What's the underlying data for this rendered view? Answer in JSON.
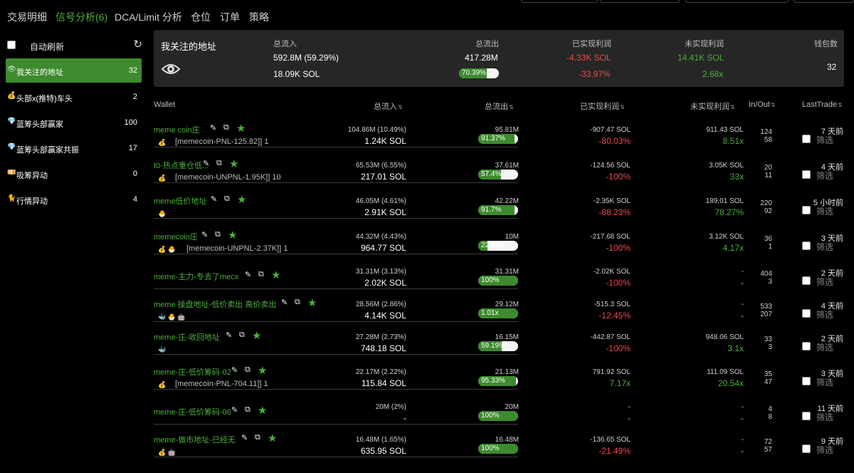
{
  "nav": {
    "tabs": [
      "交易明细",
      "信号分析(6)",
      "DCA/Limit 分析",
      "仓位",
      "订单",
      "策略"
    ],
    "active_index": 1
  },
  "sidebar": {
    "auto_refresh_label": "自动刷新",
    "items": [
      {
        "icon": "eye-icon",
        "glyph": "👁",
        "label": "我关注的地址",
        "count": "32",
        "active": true
      },
      {
        "icon": "money-bag-icon",
        "glyph": "💰",
        "label": "头部x(推特)车头",
        "count": "2"
      },
      {
        "icon": "diamond-icon",
        "glyph": "💎",
        "label": "蓝筹头部赢家",
        "count": "100"
      },
      {
        "icon": "diamond-icon",
        "glyph": "💎",
        "label": "蓝筹头部赢家共振",
        "count": "17"
      },
      {
        "icon": "cash-icon",
        "glyph": "💴",
        "label": "吸筹异动",
        "count": "0"
      },
      {
        "icon": "cat-icon",
        "glyph": "🐈",
        "label": "行情异动",
        "count": "4"
      }
    ]
  },
  "summary": {
    "title": "我关注的地址",
    "h_inflow": "总流入",
    "h_outflow": "总流出",
    "h_realized": "已实现利润",
    "h_unrealized": "未实现利润",
    "h_wallets": "钱包数",
    "inflow_1": "592.8M (59.29%)",
    "inflow_2": "18.09K SOL",
    "outflow": "417.28M",
    "outflow_pct": "70.39%",
    "outflow_pct_value": 70.39,
    "realized_1": "-4.33K SOL",
    "realized_2": "-33.97%",
    "unrealized_1": "14.41K SOL",
    "unrealized_2": "2.68x",
    "wallets": "32"
  },
  "table": {
    "headers": {
      "wallet": "Wallet",
      "inflow": "总流入",
      "outflow": "总流出",
      "realized": "已实现利润",
      "unrealized": "未实现利润",
      "inout": "In/Out",
      "lasttrade": "LastTrade"
    },
    "filter_label": "筛选",
    "rows": [
      {
        "name": "meme coin庄",
        "emojis": "💰",
        "tag": "[memecoin-PNL-125.82]] 1",
        "in1": "104.86M (10.49%)",
        "in2": "1.24K SOL",
        "out1": "95.81M",
        "outpct": "91.37%",
        "outval": 91.37,
        "r1": "-907.47 SOL",
        "r2": "-80.03%",
        "rcolor": "red",
        "u1": "911.43 SOL",
        "u2": "8.51x",
        "ucolor": "green",
        "inn": "124",
        "outn": "58",
        "last": "7 天前"
      },
      {
        "name": "t0-热点重仓低...",
        "emojis": "💰",
        "tag": "[memecoin-UNPNL-1.95K]] 10",
        "in1": "65.53M (6.55%)",
        "in2": "217.01 SOL",
        "out1": "37.61M",
        "outpct": "57.4%",
        "outval": 57.4,
        "r1": "-124.56 SOL",
        "r2": "-100%",
        "rcolor": "red",
        "u1": "3.05K SOL",
        "u2": "33x",
        "ucolor": "green",
        "inn": "20",
        "outn": "11",
        "last": "4 天前"
      },
      {
        "name": "meme低价地址",
        "emojis": "🐣",
        "tag": "",
        "in1": "46.05M (4.61%)",
        "in2": "2.91K SOL",
        "out1": "42.22M",
        "outpct": "91.7%",
        "outval": 91.7,
        "r1": "-2.35K SOL",
        "r2": "-88.23%",
        "rcolor": "red",
        "u1": "189.01 SOL",
        "u2": "78.27%",
        "ucolor": "green",
        "inn": "220",
        "outn": "92",
        "last": "5 小时前"
      },
      {
        "name": "memecoin庄",
        "emojis": "💰 🐣",
        "tag": "[memecoin-UNPNL-2.37K]] 1",
        "in1": "44.32M (4.43%)",
        "in2": "964.77 SOL",
        "out1": "10M",
        "outpct": "22.56%",
        "outval": 22.56,
        "r1": "-217.68 SOL",
        "r2": "-100%",
        "rcolor": "red",
        "u1": "3.12K SOL",
        "u2": "4.17x",
        "ucolor": "green",
        "inn": "36",
        "outn": "1",
        "last": "3 天前"
      },
      {
        "name": "meme-主力-专去了mecx",
        "emojis": "",
        "tag": "",
        "in1": "31.31M (3.13%)",
        "in2": "2.02K SOL",
        "out1": "31.31M",
        "outpct": "100%",
        "outval": 100,
        "r1": "-2.02K SOL",
        "r2": "-100%",
        "rcolor": "red",
        "u1": "-",
        "u2": "-",
        "ucolor": "grey",
        "inn": "404",
        "outn": "3",
        "last": "2 天前"
      },
      {
        "name": "meme 操盘地址-低价卖出 高价卖出",
        "emojis": "🐳 🐣 🤖",
        "tag": "",
        "in1": "28.56M (2.86%)",
        "in2": "4.14K SOL",
        "out1": "29.12M",
        "outpct": "1.01x",
        "outval": 100,
        "r1": "-515.3 SOL",
        "r2": "-12.45%",
        "rcolor": "red",
        "u1": "-",
        "u2": "-",
        "ucolor": "grey",
        "inn": "533",
        "outn": "207",
        "last": "4 天前"
      },
      {
        "name": "meme-庄-收回地址",
        "emojis": "🐳",
        "tag": "",
        "in1": "27.28M (2.73%)",
        "in2": "748.18 SOL",
        "out1": "16.15M",
        "outpct": "59.19%",
        "outval": 59.19,
        "r1": "-442.87 SOL",
        "r2": "-100%",
        "rcolor": "red",
        "u1": "948.06 SOL",
        "u2": "3.1x",
        "ucolor": "green",
        "inn": "33",
        "outn": "3",
        "last": "2 天前"
      },
      {
        "name": "meme-庄-低价筹码-02",
        "emojis": "💰",
        "tag": "[memecoin-PNL-704.11]] 1",
        "in1": "22.17M (2.22%)",
        "in2": "115.84 SOL",
        "out1": "21.13M",
        "outpct": "95.33%",
        "outval": 95.33,
        "r1": "791.92 SOL",
        "r2": "7.17x",
        "rcolor": "green",
        "u1": "111.09 SOL",
        "u2": "20.54x",
        "ucolor": "green",
        "inn": "35",
        "outn": "47",
        "last": "3 天前"
      },
      {
        "name": "meme-庄-低价筹码-06",
        "emojis": "",
        "tag": "",
        "in1": "20M (2%)",
        "in2": "-",
        "out1": "20M",
        "outpct": "100%",
        "outval": 100,
        "r1": "-",
        "r2": "-",
        "rcolor": "grey",
        "u1": "-",
        "u2": "-",
        "ucolor": "grey",
        "inn": "4",
        "outn": "8",
        "last": "11 天前"
      },
      {
        "name": "meme-做市地址-已经无",
        "emojis": "💰 🤖",
        "tag": "",
        "in1": "16.48M (1.65%)",
        "in2": "635.95 SOL",
        "out1": "16.48M",
        "outpct": "100%",
        "outval": 100,
        "r1": "-136.65 SOL",
        "r2": "-21.49%",
        "rcolor": "red",
        "u1": "-",
        "u2": "-",
        "ucolor": "grey",
        "inn": "72",
        "outn": "57",
        "last": "9 天前"
      }
    ]
  }
}
